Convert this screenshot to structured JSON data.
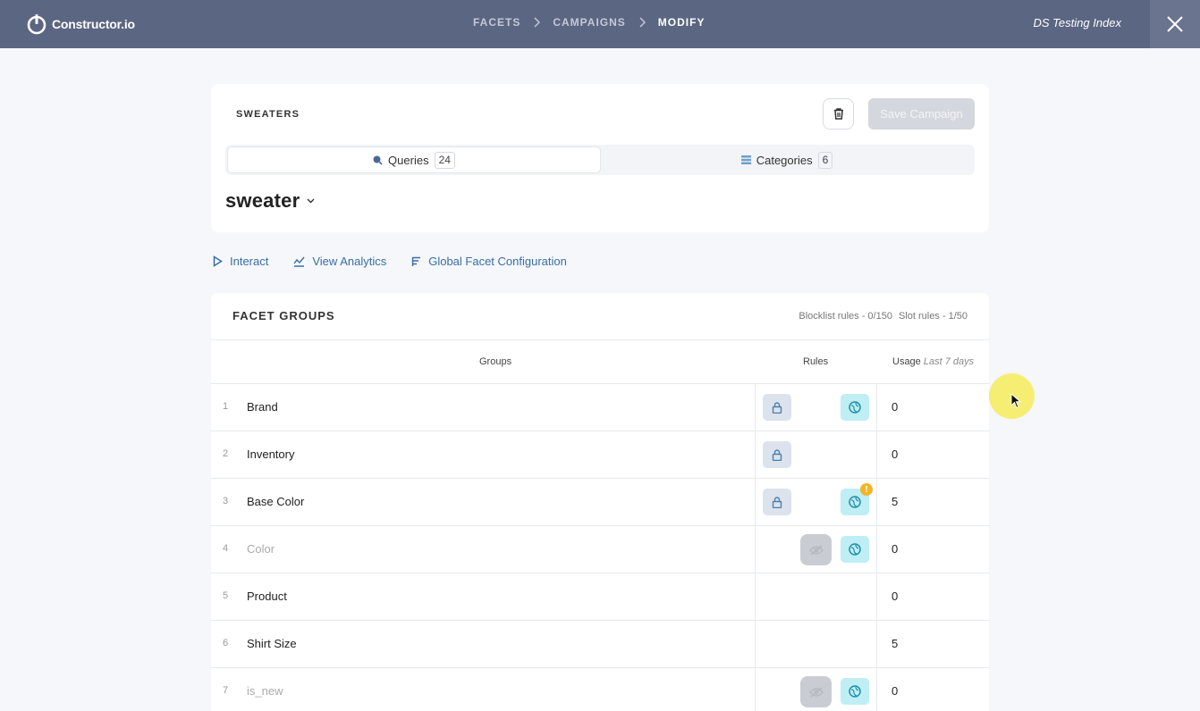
{
  "header": {
    "logo_text": "Constructor.io",
    "breadcrumbs": [
      "FACETS",
      "CAMPAIGNS",
      "MODIFY"
    ],
    "index_name": "DS Testing Index"
  },
  "campaign": {
    "name": "SWEATERS",
    "save_label": "Save Campaign",
    "tabs": [
      {
        "label": "Queries",
        "count": "24"
      },
      {
        "label": "Categories",
        "count": "6"
      }
    ],
    "selected_query": "sweater"
  },
  "actions": {
    "interact": "Interact",
    "analytics": "View Analytics",
    "global_config": "Global Facet Configuration"
  },
  "facet_groups": {
    "title": "FACET GROUPS",
    "blocklist_rules": "Blocklist rules - 0/150",
    "slot_rules": "Slot rules - 1/50",
    "columns": {
      "groups": "Groups",
      "rules": "Rules",
      "usage": "Usage",
      "usage_period": "Last 7 days"
    },
    "rows": [
      {
        "num": "1",
        "name": "Brand",
        "usage": "0"
      },
      {
        "num": "2",
        "name": "Inventory",
        "usage": "0"
      },
      {
        "num": "3",
        "name": "Base Color",
        "usage": "5"
      },
      {
        "num": "4",
        "name": "Color",
        "usage": "0"
      },
      {
        "num": "5",
        "name": "Product",
        "usage": "0"
      },
      {
        "num": "6",
        "name": "Shirt Size",
        "usage": "5"
      },
      {
        "num": "7",
        "name": "is_new",
        "usage": "0"
      }
    ],
    "warning_glyph": "!"
  },
  "colors": {
    "topbar": "#5b6682",
    "link": "#3a6ea5",
    "slot_rule": "#bfeef5",
    "warning": "#f2b52a"
  },
  "icons": {
    "lock": "lock-icon",
    "slot": "globe-icon",
    "hidden": "eye-off-icon",
    "delete": "trash-icon"
  }
}
